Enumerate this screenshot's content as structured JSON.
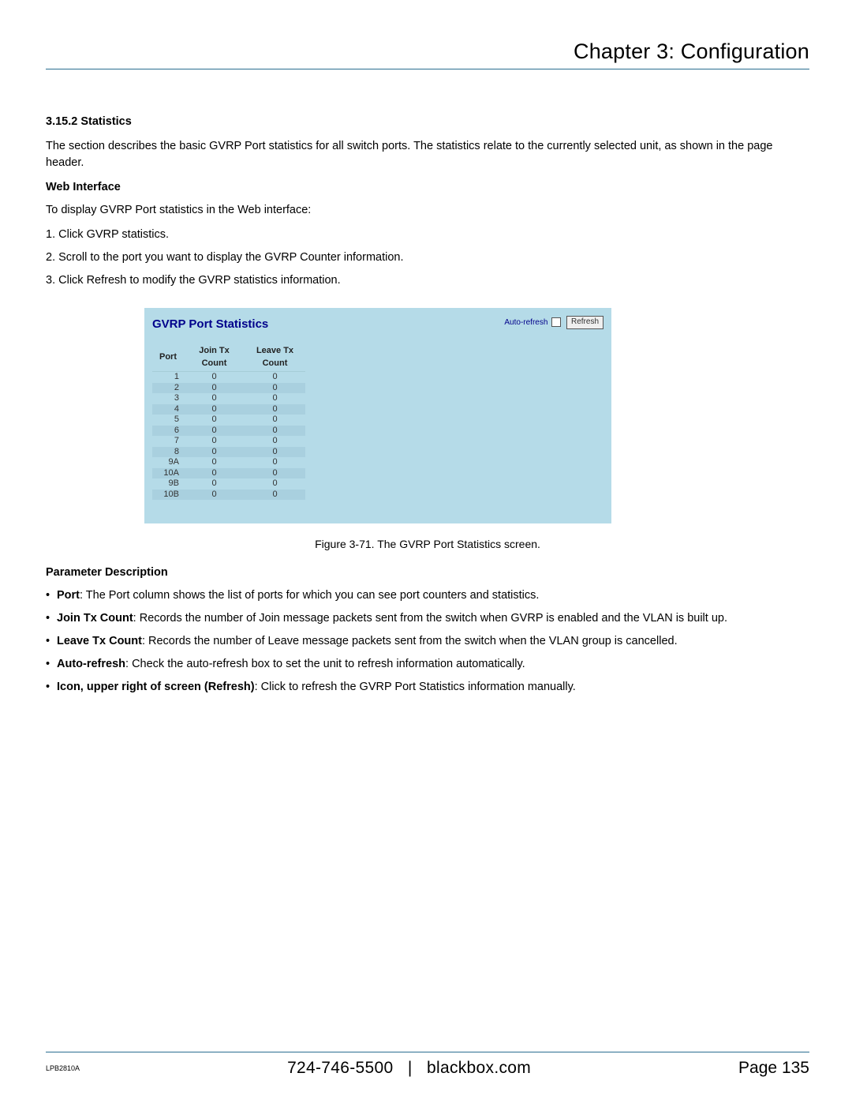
{
  "header": {
    "chapter_title": "Chapter 3: Configuration"
  },
  "section": {
    "number_title": "3.15.2 Statistics",
    "intro": "The section describes the basic GVRP Port statistics for all switch ports. The statistics relate to the currently selected unit, as shown in the page header.",
    "web_interface_heading": "Web Interface",
    "web_interface_intro": "To display GVRP Port statistics in the Web interface:",
    "steps": [
      "1. Click GVRP statistics.",
      "2. Scroll to the port you want to display the GVRP Counter information.",
      "3. Click Refresh to modify the GVRP statistics information."
    ]
  },
  "screenshot": {
    "panel_title": "GVRP Port Statistics",
    "auto_refresh_label": "Auto-refresh",
    "refresh_button": "Refresh",
    "columns": {
      "port": "Port",
      "join": "Join Tx Count",
      "leave": "Leave Tx Count"
    },
    "rows": [
      {
        "port": "1",
        "join": "0",
        "leave": "0"
      },
      {
        "port": "2",
        "join": "0",
        "leave": "0"
      },
      {
        "port": "3",
        "join": "0",
        "leave": "0"
      },
      {
        "port": "4",
        "join": "0",
        "leave": "0"
      },
      {
        "port": "5",
        "join": "0",
        "leave": "0"
      },
      {
        "port": "6",
        "join": "0",
        "leave": "0"
      },
      {
        "port": "7",
        "join": "0",
        "leave": "0"
      },
      {
        "port": "8",
        "join": "0",
        "leave": "0"
      },
      {
        "port": "9A",
        "join": "0",
        "leave": "0"
      },
      {
        "port": "10A",
        "join": "0",
        "leave": "0"
      },
      {
        "port": "9B",
        "join": "0",
        "leave": "0"
      },
      {
        "port": "10B",
        "join": "0",
        "leave": "0"
      }
    ],
    "caption": "Figure 3-71. The GVRP Port Statistics screen."
  },
  "param_desc": {
    "heading": "Parameter Description",
    "items": [
      {
        "label": "Port",
        "text": ": The Port column shows the list of ports for which you can see port counters and statistics."
      },
      {
        "label": "Join Tx Count",
        "text": ": Records the number of Join message packets sent from the switch when GVRP is enabled and the VLAN is built up."
      },
      {
        "label": "Leave Tx Count",
        "text": ": Records the number of Leave message packets sent from the switch when the VLAN group is cancelled."
      },
      {
        "label": "Auto-refresh",
        "text": ": Check the auto-refresh box to set the unit to refresh information automatically."
      },
      {
        "label": "Icon, upper right of screen (Refresh)",
        "text": ": Click to refresh the GVRP Port Statistics information manually."
      }
    ]
  },
  "footer": {
    "model": "LPB2810A",
    "phone": "724-746-5500",
    "sep": "|",
    "site": "blackbox.com",
    "page_label": "Page",
    "page_num": "135"
  }
}
